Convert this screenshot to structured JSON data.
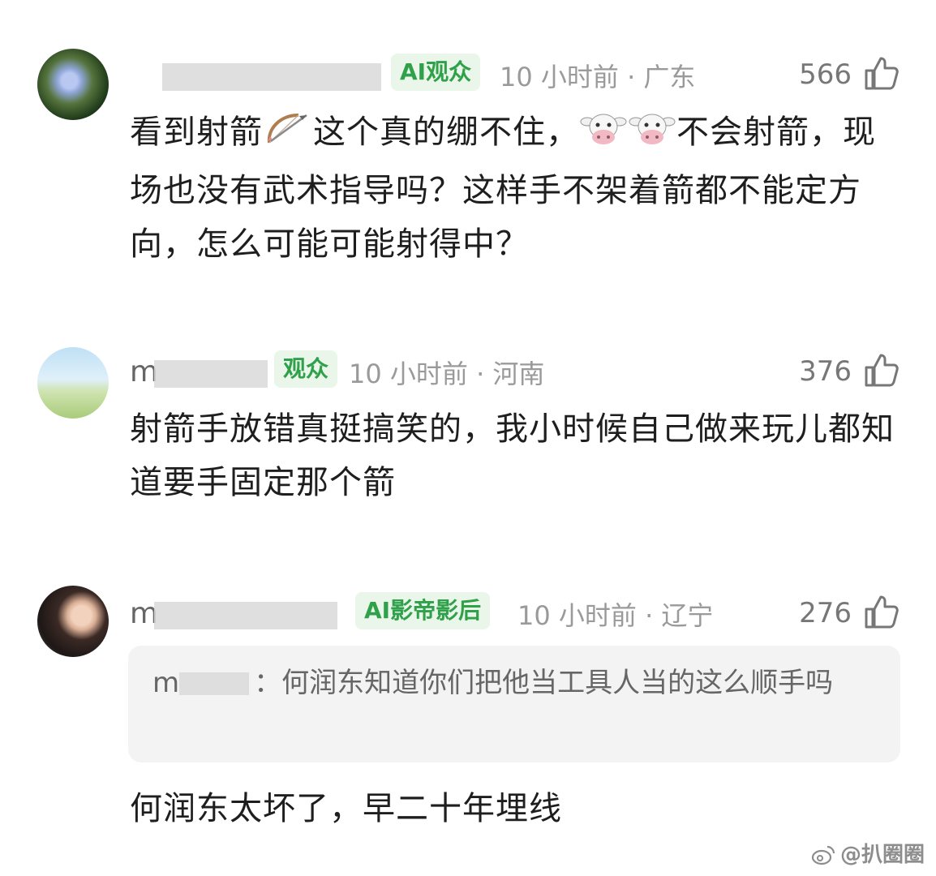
{
  "comments": [
    {
      "badge": "AI观众",
      "meta": "10 小时前 · 广东",
      "likes": "566",
      "text_a": "看到射箭",
      "text_b": "这个真的绷不住，",
      "text_c": "不会射箭，现场也没有武术指导吗？这样手不架着箭都不能定方向，怎么可能可能射得中？"
    },
    {
      "name_visible": "m",
      "badge": "观众",
      "meta": "10 小时前 · 河南",
      "likes": "376",
      "text": "射箭手放错真挺搞笑的，我小时候自己做来玩儿都知道要手固定那个箭"
    },
    {
      "name_visible": "m",
      "badge": "AI影帝影后",
      "meta": "10 小时前 · 辽宁",
      "likes": "276",
      "quote_name": "m",
      "quote_text": "：何润东知道你们把他当工具人当的这么顺手吗",
      "text": "何润东太坏了，早二十年埋线"
    }
  ],
  "watermark": "@扒圈圈",
  "icons": {
    "like": "thumb-up-icon",
    "arrow": "bow-and-arrow-icon",
    "cow": "cow-face-icon",
    "weibo": "weibo-logo-icon"
  },
  "colors": {
    "badge_text": "#2fa14a",
    "badge_bg": "#eaf6ea"
  }
}
